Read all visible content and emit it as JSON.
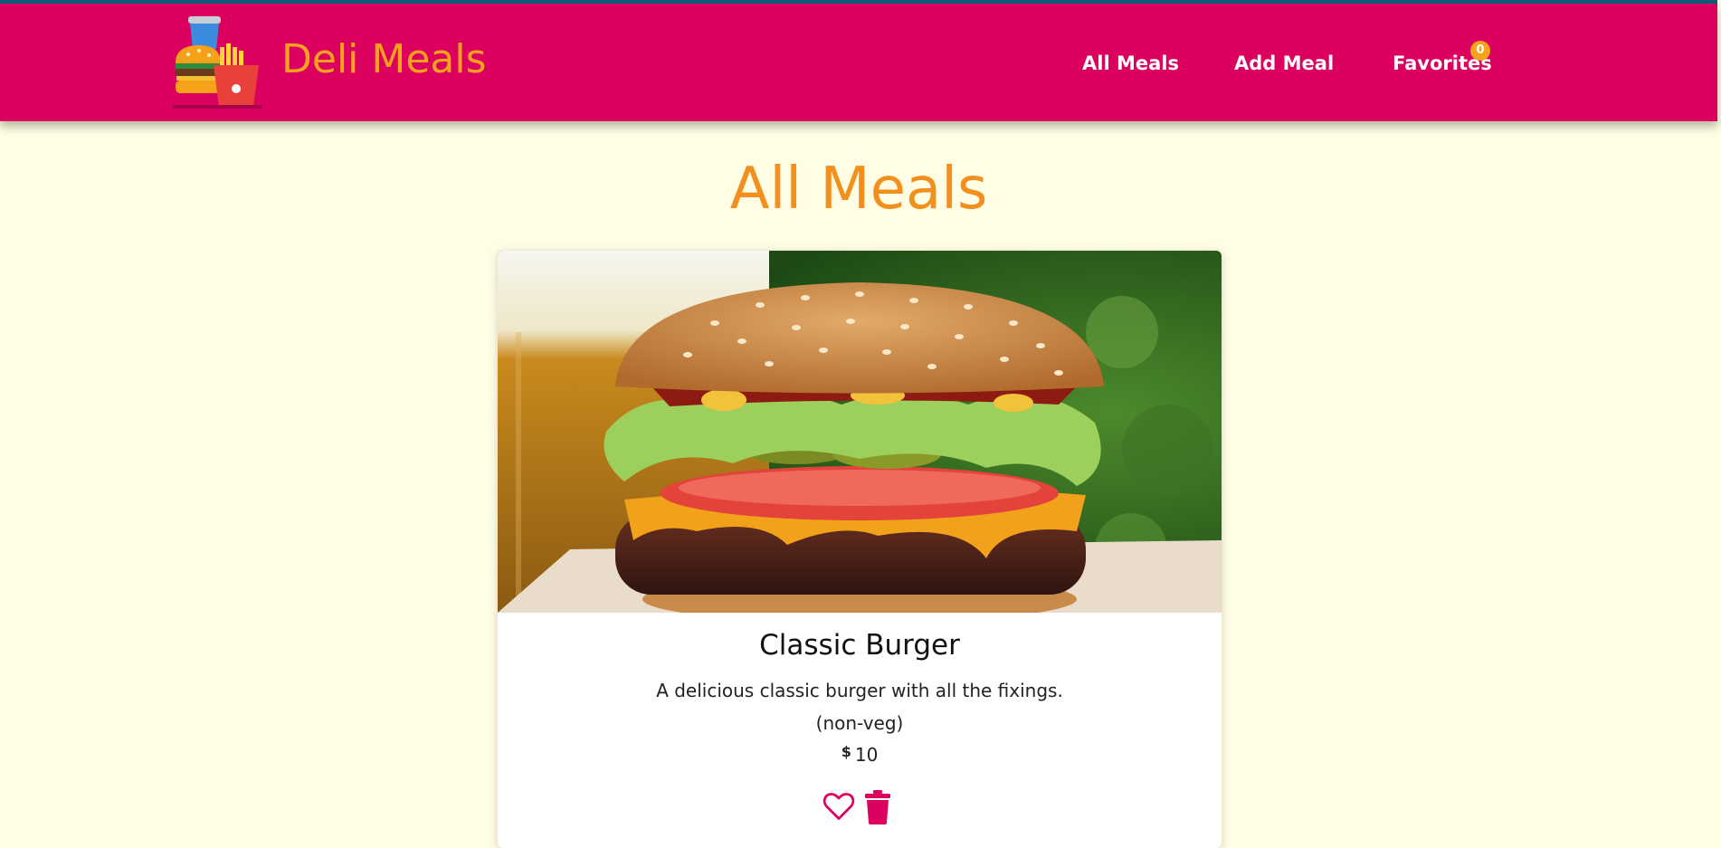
{
  "app": {
    "brand": "Deli Meals"
  },
  "nav": {
    "items": [
      {
        "label": "All Meals"
      },
      {
        "label": "Add Meal"
      },
      {
        "label": "Favorites",
        "badge": "0"
      }
    ]
  },
  "page": {
    "title": "All Meals"
  },
  "meals": [
    {
      "name": "Classic Burger",
      "description": "A delicious classic burger with all the fixings.",
      "type": "(non-veg)",
      "currency": "$",
      "price": "10",
      "favorite_icon": "heart-outline-icon",
      "delete_icon": "trash-icon"
    }
  ],
  "colors": {
    "header_bg": "#dc005f",
    "brand": "#f7a21c",
    "page_bg": "#fffde3",
    "title": "#f28f1d",
    "accent": "#dc005f"
  }
}
